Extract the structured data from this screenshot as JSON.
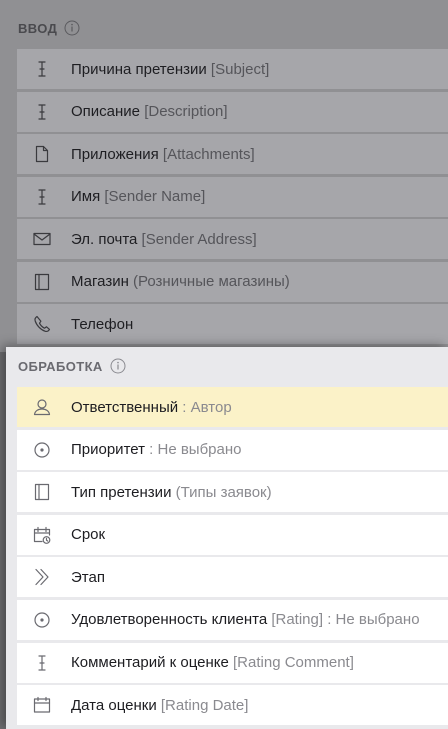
{
  "input_section": {
    "title": "ВВОД",
    "rows": [
      {
        "icon": "text-cursor-icon",
        "main": "Причина претензии",
        "extra": " [Subject]"
      },
      {
        "icon": "text-cursor-icon",
        "main": "Описание",
        "extra": " [Description]"
      },
      {
        "icon": "file-icon",
        "main": "Приложения",
        "extra": " [Attachments]"
      },
      {
        "icon": "text-cursor-icon",
        "main": "Имя",
        "extra": " [Sender Name]"
      },
      {
        "icon": "envelope-icon",
        "main": "Эл. почта",
        "extra": " [Sender Address]"
      },
      {
        "icon": "book-icon",
        "main": "Магазин",
        "extra": " (Розничные магазины)"
      },
      {
        "icon": "phone-icon",
        "main": "Телефон",
        "extra": ""
      }
    ]
  },
  "process_section": {
    "title": "ОБРАБОТКА",
    "rows": [
      {
        "icon": "user-icon",
        "main": "Ответственный",
        "extra": " : Автор"
      },
      {
        "icon": "radio-icon",
        "main": "Приоритет",
        "extra": " : Не выбрано"
      },
      {
        "icon": "book-icon",
        "main": "Тип претензии",
        "extra": " (Типы заявок)"
      },
      {
        "icon": "calendar-clock-icon",
        "main": "Срок",
        "extra": ""
      },
      {
        "icon": "chevron-right-icon",
        "main": "Этап",
        "extra": ""
      },
      {
        "icon": "radio-icon",
        "main": "Удовлетворенность клиента",
        "extra": " [Rating] : Не выбрано"
      },
      {
        "icon": "text-cursor-icon",
        "main": "Комментарий к оценке",
        "extra": " [Rating Comment]"
      },
      {
        "icon": "calendar-icon",
        "main": "Дата оценки",
        "extra": " [Rating Date]"
      }
    ]
  },
  "colors": {
    "highlight_row": "#fbf2c8",
    "icon_input": "#3a3a3e",
    "icon_process": "#6a6a70"
  }
}
